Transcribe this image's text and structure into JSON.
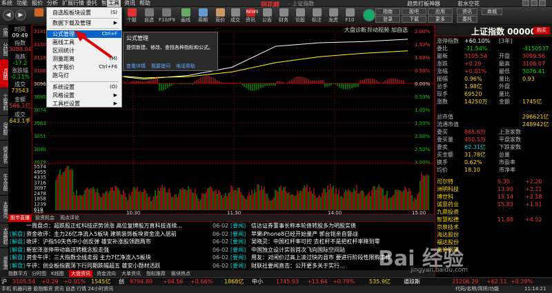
{
  "menubar": {
    "items": [
      "系统",
      "功能",
      "报价",
      "分析",
      "扩展行情",
      "委托",
      "智能",
      "工具",
      "资讯",
      "帮助"
    ],
    "brand": "同花顺",
    "subtitle": "- 上证指数",
    "tagline": "趋势打板神器",
    "user": "若水空花"
  },
  "toolbar": {
    "left_buttons": [
      "分时/K线",
      "个股",
      "自选",
      "综合排名",
      "牛叉诊股",
      "F10/F9",
      "画线",
      "周期",
      "竞价",
      "成交",
      "资讯",
      "NEWS",
      "公告",
      "财务",
      "论股",
      "标注",
      "龙虎",
      "F10"
    ],
    "right_buttons": [
      "指南",
      "股吧",
      "应用",
      "登录",
      "下载",
      "更多",
      "资讯",
      "委托",
      "商城"
    ]
  },
  "sidebar_tabs": [
    "应用",
    "分时图",
    "K线图",
    "个股资料",
    "自选股",
    "综合排名",
    "牛叉诊股",
    "大盘资讯",
    "大盘指标",
    "资金流",
    "港股"
  ],
  "left_info": {
    "time_label": "时间",
    "time": "09:49",
    "price_label": "指数",
    "price": "3088.04",
    "change_label": "涨跌",
    "change": "-17.2",
    "pct_label": "涨跌幅",
    "pct": "-0.11%",
    "amount_label": "成交",
    "amount": "73543",
    "vol_label": "金额",
    "vol": "566.1亿",
    "hand_label": "成交",
    "hand": "643.1手"
  },
  "menu": {
    "items": [
      {
        "label": "自选股板块设置",
        "shortcut": "(S)"
      },
      {
        "label": "数据下载及管理",
        "shortcut": "▶"
      },
      {
        "label": "公式管理",
        "shortcut": "Ctrl+F",
        "highlight": true
      },
      {
        "label": "画线工具",
        "shortcut": ""
      },
      {
        "label": "区间统计",
        "shortcut": ""
      },
      {
        "label": "测量距离",
        "shortcut": "(M)"
      },
      {
        "label": "大字报价",
        "shortcut": "Ctrl+F6"
      },
      {
        "label": "跑马灯",
        "shortcut": ""
      },
      {
        "label": "系统设置",
        "shortcut": "(O)"
      },
      {
        "label": "风格设置",
        "shortcut": "▶"
      },
      {
        "label": "工具栏设置",
        "shortcut": "▶"
      }
    ]
  },
  "tooltip": {
    "title": "公式管理",
    "desc": "提供新建、修改、查找各种指标和公式。",
    "links": [
      "查看详情",
      "我要提问",
      "电话帮助"
    ]
  },
  "chart": {
    "header_right": [
      "大盘诊断",
      "异动视频",
      "加自选"
    ],
    "y_left": [
      "3141",
      "3130",
      "3119",
      "3108",
      "3096",
      "3085",
      "3074",
      "3063",
      "3051",
      "3040",
      "3029"
    ],
    "y_right": [
      "2.00%",
      "1.50%",
      "1.00%",
      "0.50%",
      "0.00%",
      "0.50%",
      "1.00%",
      "1.50%",
      "2.00%",
      "2.50%",
      "3.00%"
    ],
    "vol_left": [
      "5574",
      "4955",
      "4335",
      "3716",
      "3097",
      "2478",
      "1858",
      "1239",
      "619"
    ],
    "vol_x10": "X10",
    "x_labels": [
      "10:30",
      "11:30",
      "14:00",
      "15:00"
    ]
  },
  "chart_data": {
    "type": "line",
    "title": "",
    "x": [
      "09:30",
      "10:00",
      "10:30",
      "11:00",
      "11:30",
      "13:30",
      "14:00",
      "14:30",
      "15:00"
    ],
    "series": [
      {
        "values": [
          3106,
          3104,
          3100,
          3103,
          3110,
          3128,
          3131,
          3132,
          3134
        ]
      },
      {
        "values": [
          3106,
          3104,
          3101,
          3102,
          3106,
          3114,
          3119,
          3122,
          3124
        ]
      }
    ],
    "ylim": [
      3029,
      3141
    ]
  },
  "quote": {
    "title": "上证指数 000001",
    "buy_btn": "购买",
    "rows": [
      {
        "a": "涨停指数",
        "b": "+60.10%",
        "c": "[3年]",
        "ca": "yel",
        "d": "",
        "e": ""
      },
      {
        "a": "委比",
        "b": "-31.54%",
        "ba": "grn",
        "c": "",
        "d": "-4150537",
        "da": "grn"
      },
      {
        "a": "最新",
        "b": "3105.54",
        "ba": "red",
        "c": "开盘",
        "d": "3099.56",
        "da": "red"
      },
      {
        "a": "涨跌",
        "b": "+0.29",
        "ba": "red",
        "c": "最高",
        "d": "3106.07",
        "da": "red"
      },
      {
        "a": "涨幅",
        "b": "+0.01%",
        "ba": "red",
        "c": "最低",
        "d": "3076.41",
        "da": "grn"
      },
      {
        "a": "振幅",
        "b": "0.96%",
        "ba": "yel",
        "c": "量比",
        "d": "0.93",
        "da": "yel"
      },
      {
        "a": "总手",
        "b": "1.98亿",
        "ba": "yel",
        "c": "外盘",
        "d": "",
        "da": "red"
      },
      {
        "a": "现手",
        "b": "69520",
        "ba": "yel",
        "c": "量比",
        "d": "",
        "da": "yel"
      },
      {
        "a": "涨数",
        "b": "14250万",
        "ba": "yel",
        "c": "金额",
        "d": "1745亿",
        "da": "yel"
      },
      {
        "a": "",
        "b": "",
        "c": "",
        "d": "",
        "da": ""
      },
      {
        "a": "总市值",
        "b": "",
        "c": "",
        "d": "296621亿",
        "da": "yel"
      },
      {
        "a": "流通市值",
        "b": "",
        "c": "",
        "d": "248942亿",
        "da": "yel"
      },
      {
        "a": "委买",
        "b": "865.6万",
        "ba": "red",
        "c": "上涨家数",
        "d": "",
        "da": "red"
      },
      {
        "a": "委买量",
        "b": "450.5万",
        "ba": "red",
        "c": "平盘家数",
        "d": "",
        "da": "wht"
      },
      {
        "a": "委卖",
        "b": "62.31亿",
        "ba": "cyn",
        "c": "下跌家数",
        "d": "",
        "da": "grn"
      },
      {
        "a": "买金额",
        "b": "31.78亿",
        "ba": "yel",
        "c": "总量",
        "d": "",
        "da": "yel"
      },
      {
        "a": "换手",
        "b": "0.62%",
        "ba": "yel",
        "c": "市盈率",
        "d": "",
        "da": "yel"
      },
      {
        "a": "均价",
        "b": "18.10",
        "ba": "yel",
        "c": "市净率",
        "d": "",
        "da": "yel"
      }
    ],
    "stocks": [
      {
        "name": "司尔特",
        "price": "9.30",
        "pct": "+2.20",
        "pa": "red"
      },
      {
        "name": "洲明科技",
        "price": "13.90",
        "pct": "+2.21",
        "pa": "red"
      },
      {
        "name": "博世科",
        "price": "15.14",
        "pct": "+2.18",
        "pa": "red"
      },
      {
        "name": "诚意药业",
        "price": "15.83",
        "pct": "+1.51",
        "pa": "red"
      },
      {
        "name": "九鼎投资",
        "price": "",
        "pct": "",
        "pa": "red"
      },
      {
        "name": "智慧松德",
        "price": "11.88",
        "pct": "+4.52",
        "pa": "red"
      },
      {
        "name": "京泉技术",
        "price": "",
        "pct": "",
        "pa": "red"
      },
      {
        "name": "海达股份",
        "price": "",
        "pct": "",
        "pa": "red"
      },
      {
        "name": "福达股份",
        "price": "",
        "pct": "",
        "pa": "red"
      },
      {
        "name": "海伦钢琴",
        "price": "",
        "pct": "",
        "pa": "red"
      }
    ]
  },
  "infobar": {
    "tabs": [
      "股市直播",
      "投资机会",
      "观点评论"
    ],
    "news_left": [
      {
        "tag": "",
        "text": "一周盘点：超跌股正虹科技逆势领涨 高位复牌股万直科技连续…",
        "date": "06-02"
      },
      {
        "tag": "[解盘]",
        "text": "资金收评：主力26亿净流入5板块 建筑装饰板块资金流入居前",
        "date": "06-02"
      },
      {
        "tag": "[解盘]",
        "text": "收评：沪指50失色中小创反弹 雄安补涨股领跑两市",
        "date": "06-02"
      },
      {
        "tag": "[解盘]",
        "text": "新宏泽涨停带动高送转概念股走强",
        "date": "06-02"
      },
      {
        "tag": "[解盘]",
        "text": "资金午评：三大指数全线走弱 主力7亿净流入5板块",
        "date": "06-02"
      },
      {
        "tag": "[解盘]",
        "text": "午评：创业板指震荡下行同期跌幅超五 雄安小题材活跃",
        "date": "06-02"
      }
    ],
    "news_right": [
      {
        "tag": "[要闻]",
        "text": "信达证券董事长称本轮债转股多为明股实债"
      },
      {
        "tag": "[要闻]",
        "text": "苹果iPhone8已经开始量产 郭台铭亲自督战"
      },
      {
        "tag": "[要闻]",
        "text": "吴晓灵：中国杠杆率可控 去杠杆不是把杠杆率降到零"
      },
      {
        "tag": "[要闻]",
        "text": "中国独立设计实验首次飞向国际空间站"
      },
      {
        "tag": "[要闻]",
        "text": "用友：对闲价过高上凌过快的县市 要进行阶段性限购工作"
      },
      {
        "tag": "[要闻]",
        "text": "财联社要闻直击：公开更多关于实行…"
      }
    ]
  },
  "bottom_tabs": [
    "指数平方",
    "分时图",
    "K线图",
    "大盘资讯",
    "资金流向",
    "大单资讯",
    "指标推荐",
    "板块热点"
  ],
  "status1": {
    "sh_label": "沪",
    "sh_price": "3105.54",
    "sh_chg": "+0.29",
    "sh_pct": "+0.01%",
    "sh_amt": "1545亿",
    "cy_label": "创",
    "cy_price": "9794.89",
    "cy_chg": "+64.56",
    "cy_pct": "+0.66%",
    "cy_amt": "1868亿",
    "zx_label": "中小",
    "zx_price": "1745.93",
    "zx_chg": "+13.64",
    "zx_pct": "+0.79%",
    "zx_amt": "535.9亿",
    "dj_label": "道琼斯",
    "dj_price": "21206.29",
    "dj_chg": "+62.11",
    "dj_pct": "+0.29%"
  },
  "status2": {
    "left": "手机 机器问答  股指期货  资讯  自选  行情  24小时资讯",
    "right": "代码/名称/简拼/功能",
    "time": "11:14:21"
  },
  "watermark": {
    "text": "Bai 经验",
    "sub": "jingyan.baidu.com"
  }
}
